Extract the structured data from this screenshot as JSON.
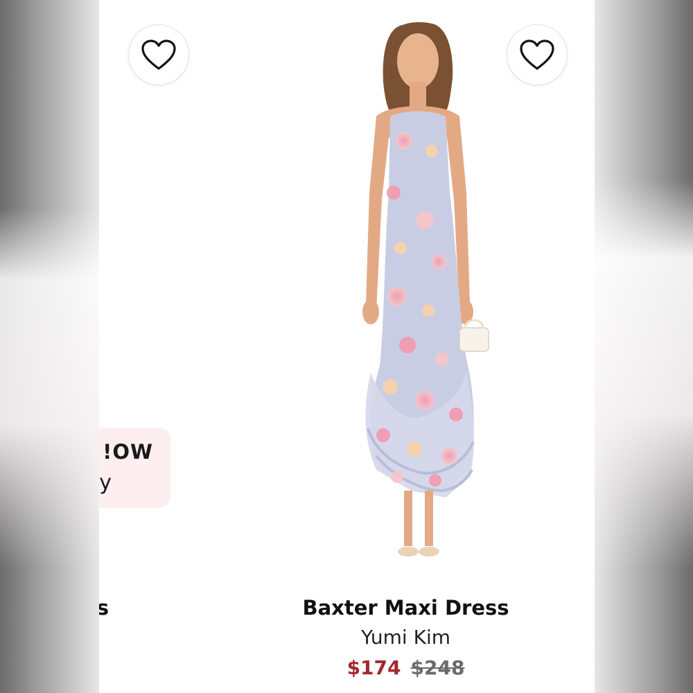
{
  "colors": {
    "sale_price": "#a3282e",
    "original_price": "#6b6b6b",
    "promo_background": "#fdeff0",
    "text_primary": "#111111"
  },
  "favorite_buttons": {
    "left_icon": "heart-outline-icon",
    "right_icon": "heart-outline-icon"
  },
  "promo_banner": {
    "title_visible": "OW!",
    "subtitle_visible": "y"
  },
  "left_product": {
    "name_visible": "s"
  },
  "product": {
    "image": "floral-maxi-dress-model",
    "name": "Baxter Maxi Dress",
    "brand": "Yumi Kim",
    "sale_price": "$174",
    "original_price": "$248"
  }
}
